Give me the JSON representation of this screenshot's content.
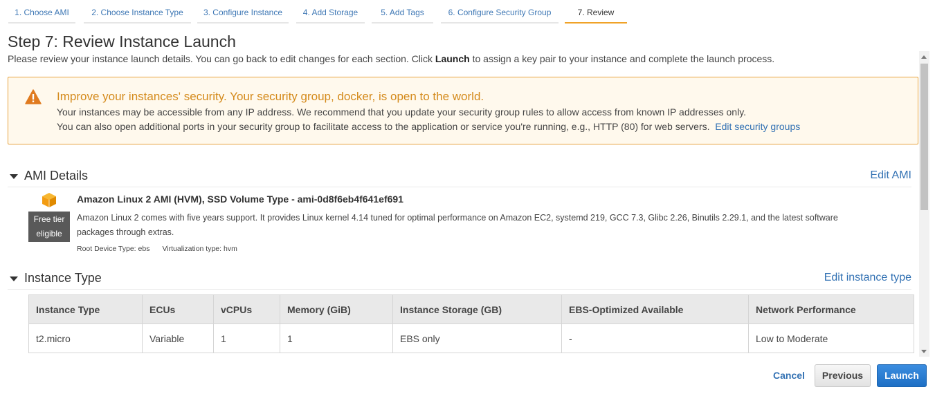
{
  "steps": [
    {
      "label": "1. Choose AMI"
    },
    {
      "label": "2. Choose Instance Type"
    },
    {
      "label": "3. Configure Instance"
    },
    {
      "label": "4. Add Storage"
    },
    {
      "label": "5. Add Tags"
    },
    {
      "label": "6. Configure Security Group"
    },
    {
      "label": "7. Review"
    }
  ],
  "active_step": "7. Review",
  "page": {
    "title": "Step 7: Review Instance Launch",
    "intro_before": "Please review your instance launch details. You can go back to edit changes for each section. Click ",
    "intro_bold": "Launch",
    "intro_after": " to assign a key pair to your instance and complete the launch process."
  },
  "warning": {
    "icon": "warning-triangle-icon",
    "title": "Improve your instances' security. Your security group, docker, is open to the world.",
    "line1": "Your instances may be accessible from any IP address. We recommend that you update your security group rules to allow access from known IP addresses only.",
    "line2": "You can also open additional ports in your security group to facilitate access to the application or service you're running, e.g., HTTP (80) for web servers.",
    "link": "Edit security groups"
  },
  "ami": {
    "section_title": "AMI Details",
    "edit_link": "Edit AMI",
    "icon": "ami-cube-icon",
    "free_tier_line1": "Free tier",
    "free_tier_line2": "eligible",
    "name": "Amazon Linux 2 AMI (HVM), SSD Volume Type - ami-0d8f6eb4f641ef691",
    "description": "Amazon Linux 2 comes with five years support. It provides Linux kernel 4.14 tuned for optimal performance on Amazon EC2, systemd 219, GCC 7.3, Glibc 2.26, Binutils 2.29.1, and the latest software packages through extras.",
    "root_device": "Root Device Type: ebs",
    "virtualization": "Virtualization type: hvm"
  },
  "instance_type": {
    "section_title": "Instance Type",
    "edit_link": "Edit instance type",
    "columns": [
      "Instance Type",
      "ECUs",
      "vCPUs",
      "Memory (GiB)",
      "Instance Storage (GB)",
      "EBS-Optimized Available",
      "Network Performance"
    ],
    "rows": [
      [
        "t2.micro",
        "Variable",
        "1",
        "1",
        "EBS only",
        "-",
        "Low to Moderate"
      ]
    ]
  },
  "footer": {
    "cancel": "Cancel",
    "previous": "Previous",
    "launch": "Launch"
  },
  "colors": {
    "link": "#3271b3",
    "warning_border": "#e7a33e",
    "warning_title": "#d48a1b",
    "active_tab_underline": "#f0a227",
    "launch_button": "#2f80d6"
  }
}
